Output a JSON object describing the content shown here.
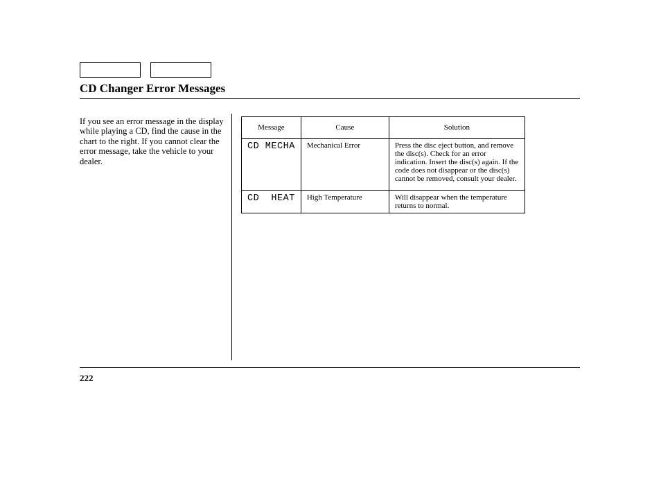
{
  "title": "CD Changer Error Messages",
  "intro": "If you see an error message in the display while playing a CD, find the cause in the chart to the right. If you cannot clear the error message, take the vehicle to your dealer.",
  "table": {
    "headers": {
      "message": "Message",
      "cause": "Cause",
      "solution": "Solution"
    },
    "rows": [
      {
        "message": "CD MECHA",
        "cause": "Mechanical Error",
        "solution": "Press the disc eject button, and remove the disc(s). Check for an error indication. Insert the disc(s) again. If the code does not disappear or the disc(s) cannot be removed, consult your dealer."
      },
      {
        "message": "CD  HEAT",
        "cause": "High Temperature",
        "solution": "Will disappear when the temperature returns to normal."
      }
    ]
  },
  "page_number": "222",
  "chart_data": {
    "type": "table",
    "title": "CD Changer Error Messages",
    "columns": [
      "Message",
      "Cause",
      "Solution"
    ],
    "rows": [
      [
        "CD MECHA",
        "Mechanical Error",
        "Press the disc eject button, and remove the disc(s). Check for an error indication. Insert the disc(s) again. If the code does not disappear or the disc(s) cannot be removed, consult your dealer."
      ],
      [
        "CD  HEAT",
        "High Temperature",
        "Will disappear when the temperature returns to normal."
      ]
    ]
  }
}
